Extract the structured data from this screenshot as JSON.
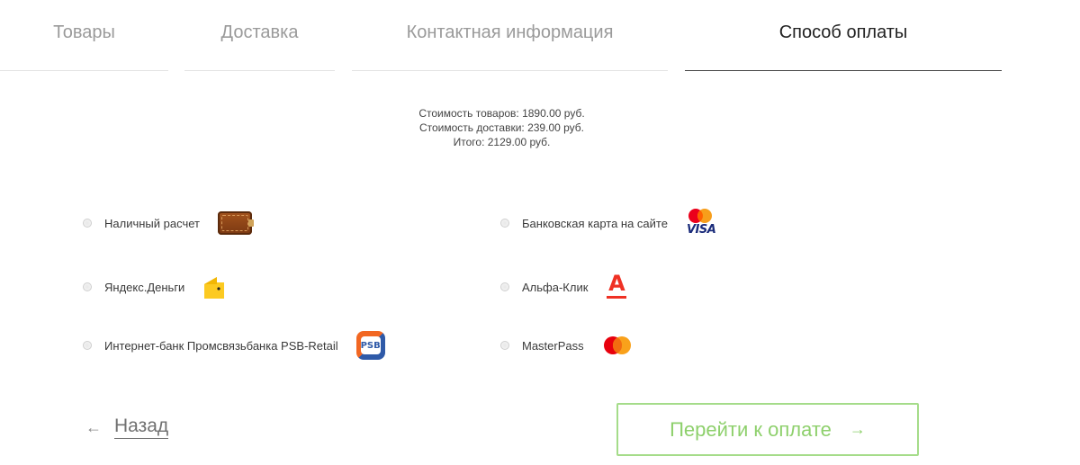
{
  "steps": [
    {
      "label": "Товары"
    },
    {
      "label": "Доставка"
    },
    {
      "label": "Контактная информация"
    },
    {
      "label": "Способ оплаты",
      "active": true
    }
  ],
  "summary": {
    "goods_cost": "Стоимость товаров: 1890.00 руб.",
    "delivery_cost": "Стоимость доставки: 239.00 руб.",
    "total": "Итого: 2129.00 руб."
  },
  "payment_options": {
    "cash": {
      "label": "Наличный расчет",
      "icon": "wallet-icon"
    },
    "bank_card": {
      "label": "Банковская карта на сайте",
      "icon": "mastercard-visa-icon",
      "logo_text": "VISA",
      "mc_text": "MasterCard"
    },
    "yandex_money": {
      "label": "Яндекс.Деньги",
      "icon": "yandex-money-icon"
    },
    "alfa_click": {
      "label": "Альфа-Клик",
      "icon": "alfa-bank-icon",
      "logo_text": "А"
    },
    "psb": {
      "label": "Интернет-банк Промсвязьбанка PSB-Retail",
      "icon": "psb-icon",
      "logo_text": "PSB"
    },
    "masterpass": {
      "label": "MasterPass",
      "icon": "masterpass-icon"
    }
  },
  "nav": {
    "back_arrow": "←",
    "back_label": "Назад",
    "pay_label": "Перейти к оплате",
    "pay_arrow": "→"
  },
  "colors": {
    "accent_green": "#8ed06c",
    "alfa_red": "#ef3124",
    "wallet_brown": "#8a4417",
    "yandex_yellow": "#fcca21"
  }
}
